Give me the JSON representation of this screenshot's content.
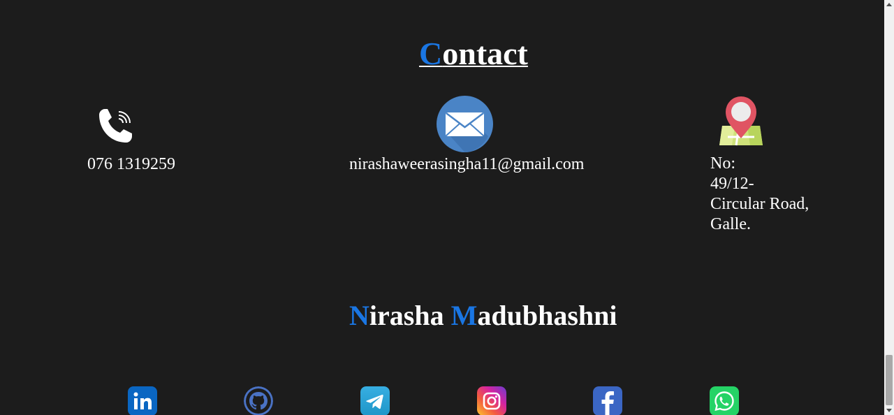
{
  "contact": {
    "title_initial": "C",
    "title_rest": "ontact"
  },
  "phone": {
    "icon": "phone-icon",
    "number": "076 1319259"
  },
  "email": {
    "icon": "envelope-icon",
    "address": "nirashaweerasingha11@gmail.com"
  },
  "location": {
    "icon": "map-pin-icon",
    "lines": [
      "No:",
      "49/12-",
      "Circular Road,",
      "Galle."
    ]
  },
  "name": {
    "first_initial": "N",
    "first_rest": "irasha ",
    "last_initial": "M",
    "last_rest": "adubhashni"
  },
  "social": [
    {
      "name": "linkedin-icon",
      "color": "#0a66c2"
    },
    {
      "name": "github-icon",
      "color": "#4a72c4"
    },
    {
      "name": "telegram-icon",
      "color": "#2aa3e0"
    },
    {
      "name": "instagram-icon",
      "color": "#d6249f"
    },
    {
      "name": "facebook-icon",
      "color": "#3b66c4"
    },
    {
      "name": "whatsapp-icon",
      "color": "#25d366"
    }
  ],
  "colors": {
    "background": "#1c1c1c",
    "accent": "#1a76e3",
    "text": "#ffffff"
  }
}
